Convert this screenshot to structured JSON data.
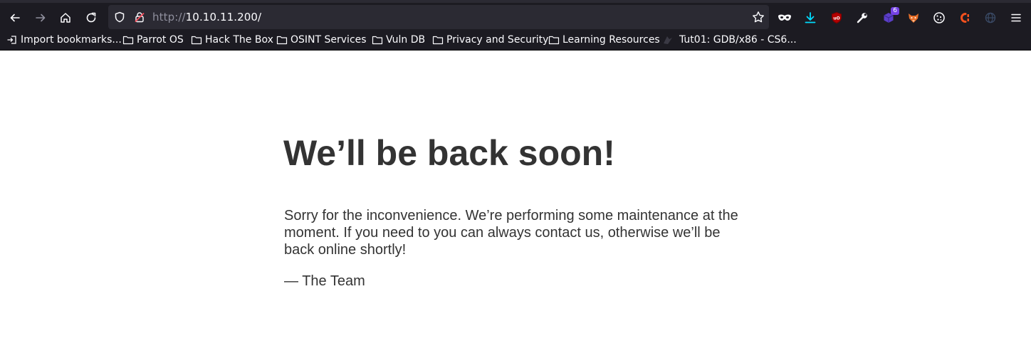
{
  "browser": {
    "url_scheme": "http://",
    "url_host": "10.10.11.200/",
    "extension_badge_count": "6",
    "bookmarks": [
      {
        "label": "Import bookmarks..."
      },
      {
        "label": "Parrot OS"
      },
      {
        "label": "Hack The Box"
      },
      {
        "label": "OSINT Services"
      },
      {
        "label": "Vuln DB"
      },
      {
        "label": "Privacy and Security"
      },
      {
        "label": "Learning Resources"
      },
      {
        "label": "Tut01: GDB/x86 - CS6..."
      }
    ],
    "icons": {
      "back": "back-arrow-icon",
      "forward": "forward-arrow-icon",
      "home": "home-icon",
      "reload": "reload-icon",
      "tracking": "shield-icon",
      "insecure": "insecure-lock-icon",
      "bookmark_star": "star-icon",
      "downloads": "download-icon",
      "menu": "hamburger-menu-icon"
    }
  },
  "page": {
    "headline": "We’ll be back soon!",
    "message": "Sorry for the inconvenience. We’re performing some maintenance at the moment. If you need to you can always contact us, otherwise we’ll be back online shortly!",
    "signature": "— The Team"
  },
  "colors": {
    "chrome_bg": "#1c1b22",
    "urlbar_bg": "#2b2a33",
    "page_text": "#333333",
    "download_accent": "#00ddff"
  }
}
